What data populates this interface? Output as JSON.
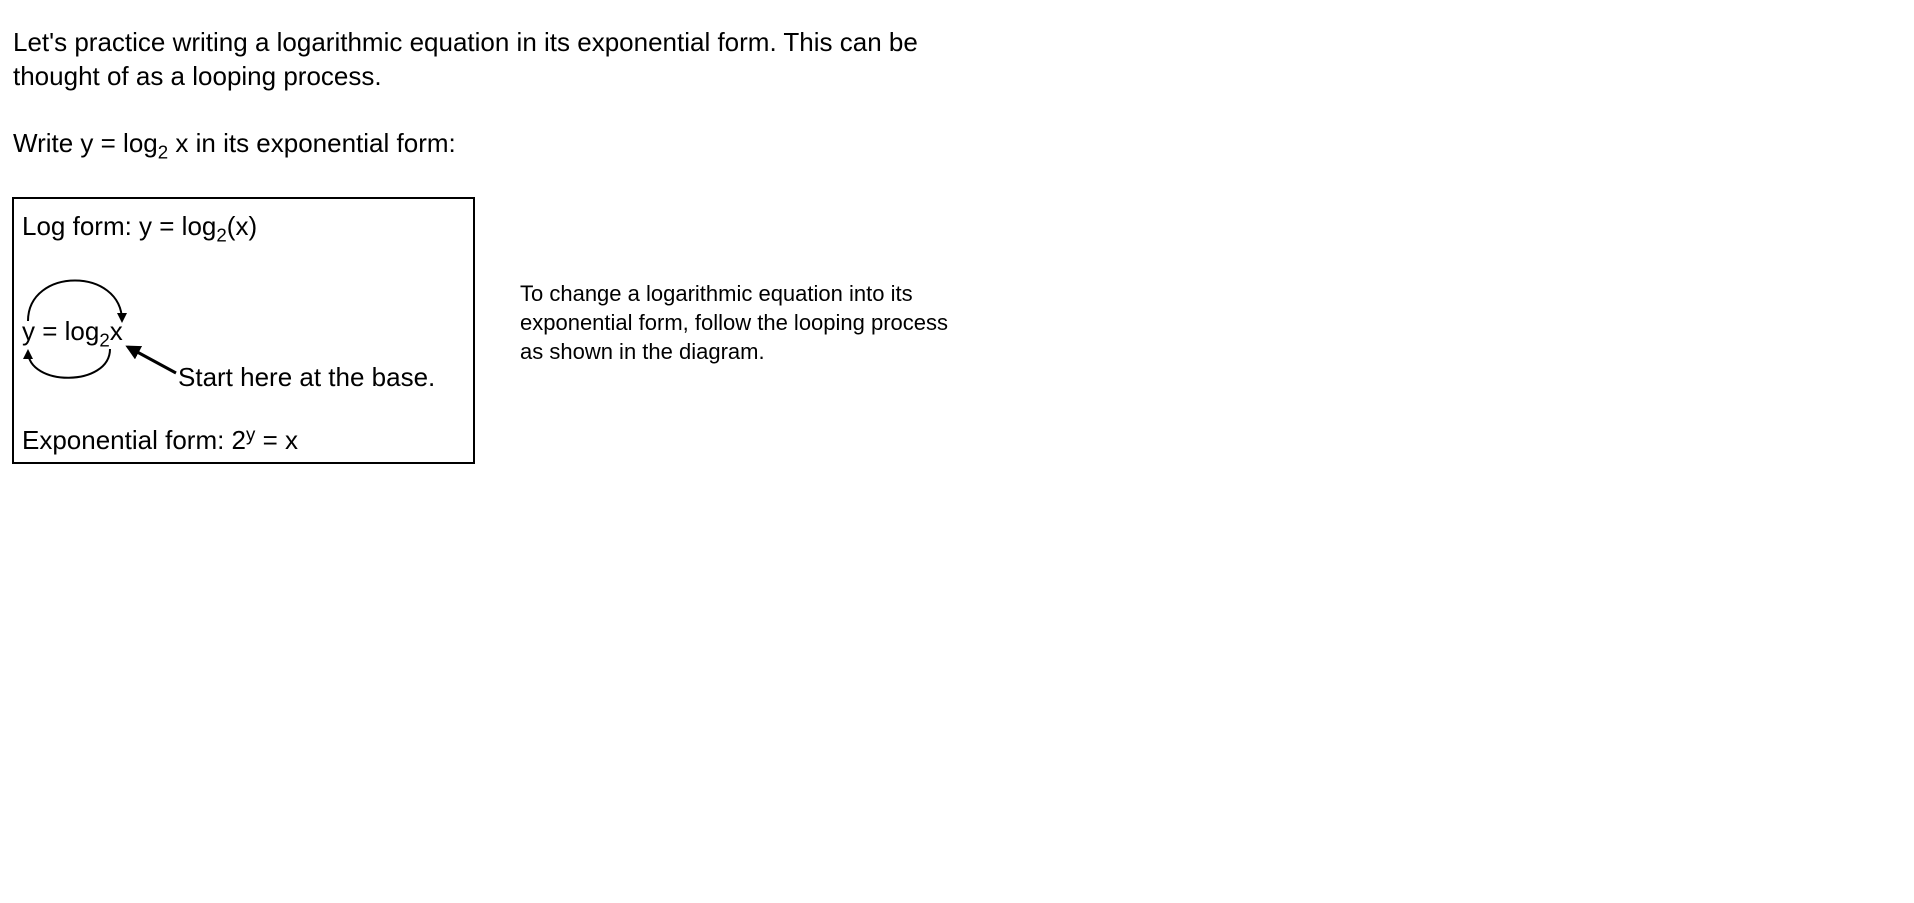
{
  "intro": {
    "line1": "Let's practice writing a logarithmic equation in its exponential form.  This can be",
    "line2": "thought of as a looping process."
  },
  "prompt": {
    "before_sub": "Write y = log",
    "base": "2",
    "after_sub": " x in its exponential form:"
  },
  "diagram": {
    "log_form": {
      "prefix": "Log form:  y = log",
      "base": "2",
      "suffix": "(x)"
    },
    "loop_equation": {
      "prefix": "y = log",
      "base": "2",
      "suffix": "x"
    },
    "start_label": "Start here at the base.",
    "exponential_form": {
      "prefix": "Exponential form:  2",
      "exponent": "y",
      "suffix": " = x"
    }
  },
  "note": {
    "line1": "To change a logarithmic equation into its",
    "line2": "exponential form, follow the looping process",
    "line3": "as shown in the diagram."
  }
}
